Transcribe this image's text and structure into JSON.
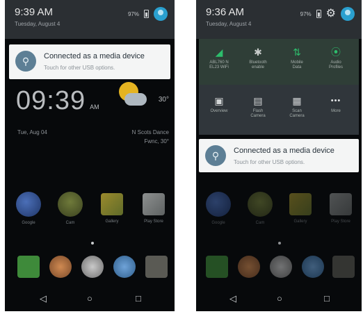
{
  "left": {
    "header": {
      "time": "9:39 AM",
      "date": "Tuesday, August 4",
      "battery_pct": "97%"
    },
    "notification": {
      "title": "Connected as a media device",
      "subtitle": "Touch for other USB options."
    },
    "lockscreen": {
      "clock": "09:39",
      "ampm": "AM",
      "temperature": "30°",
      "date": "Tue, Aug 04",
      "location_line1": "N Scots Dance",
      "location_line2": "Fwnc, 30°"
    },
    "apps": [
      "Google",
      "Cam",
      "Gallery",
      "Play Store"
    ]
  },
  "right": {
    "header": {
      "time": "9:36 AM",
      "date": "Tuesday, August 4",
      "battery_pct": "97%"
    },
    "quick_settings": {
      "row1": [
        {
          "icon": "wifi-icon",
          "glyph": "◢",
          "label": "ABL760 N\nEL23 WiFi"
        },
        {
          "icon": "bluetooth-icon",
          "glyph": "✱",
          "label": "Bluetooth\nenable"
        },
        {
          "icon": "mobile-data-icon",
          "glyph": "⇅",
          "label": "Mobile\nData"
        },
        {
          "icon": "location-icon",
          "glyph": "⦿",
          "label": "Audio\nProfiles"
        }
      ],
      "row2": [
        {
          "icon": "screenshot-icon",
          "glyph": "▣",
          "label": "Overview"
        },
        {
          "icon": "flash-icon",
          "glyph": "▤",
          "label": "Flash\nCamera"
        },
        {
          "icon": "scan-icon",
          "glyph": "▦",
          "label": "Scan\nCamera"
        },
        {
          "icon": "more-icon",
          "glyph": "•••",
          "label": "More"
        }
      ]
    },
    "notification": {
      "title": "Connected as a media device",
      "subtitle": "Touch for other USB options."
    },
    "apps": [
      "Google",
      "Cam",
      "Gallery",
      "Play Store"
    ]
  },
  "nav": {
    "back": "◁",
    "home": "○",
    "recents": "□"
  },
  "colors": {
    "accent": "#2aa0cf",
    "qs_row1": "#2f3e37",
    "qs_icon_green": "#2dbe6c",
    "usb_icon": "#5d7f95"
  }
}
